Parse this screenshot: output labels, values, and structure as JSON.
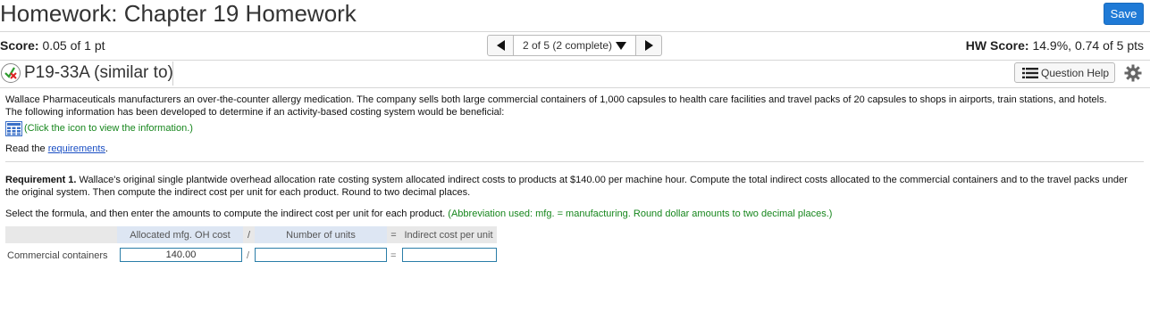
{
  "header": {
    "title": "Homework: Chapter 19 Homework",
    "save_label": "Save"
  },
  "score_bar": {
    "score_label": "Score:",
    "score_value": "0.05 of 1 pt",
    "pager_text": "2 of 5 (2 complete)",
    "hw_score_label": "HW Score:",
    "hw_score_value": "14.9%, 0.74 of 5 pts"
  },
  "question": {
    "id": "P19-33A (similar to)",
    "help_label": "Question Help"
  },
  "body": {
    "intro": "Wallace Pharmaceuticals manufacturers an over-the-counter allergy medication. The company sells both large commercial containers of 1,000 capsules to health care facilities and travel packs of 20 capsules to shops in airports, train stations, and hotels. The following information has been developed to determine if an activity-based costing system would be beneficial:",
    "click_info": "(Click the icon to view the information.)",
    "read_the": "Read the ",
    "requirements_link": "requirements",
    "period": ".",
    "req_label": "Requirement 1.",
    "req_text": " Wallace's original single plantwide overhead allocation rate costing system allocated indirect costs to products at $140.00 per machine hour. Compute the total indirect costs allocated to the commercial containers and to the travel packs under the original system. Then compute the indirect cost per unit for each product. Round to two decimal places.",
    "instruction": "Select the formula, and then enter the amounts to compute the indirect cost per unit for each product. ",
    "instruction_hint": "(Abbreviation used: mfg. = manufacturing. Round dollar amounts to two decimal places.)"
  },
  "table": {
    "headers": [
      "Allocated mfg. OH cost",
      "/",
      "Number of units",
      "=",
      "Indirect cost per unit"
    ],
    "rows": [
      {
        "label": "Commercial containers",
        "allocated": "140.00",
        "op1": "/",
        "units": "",
        "op2": "=",
        "per_unit": ""
      }
    ]
  },
  "colors": {
    "save_button": "#1f7ad6",
    "hint_green": "#16861c",
    "link_blue": "#1a4fc4"
  }
}
